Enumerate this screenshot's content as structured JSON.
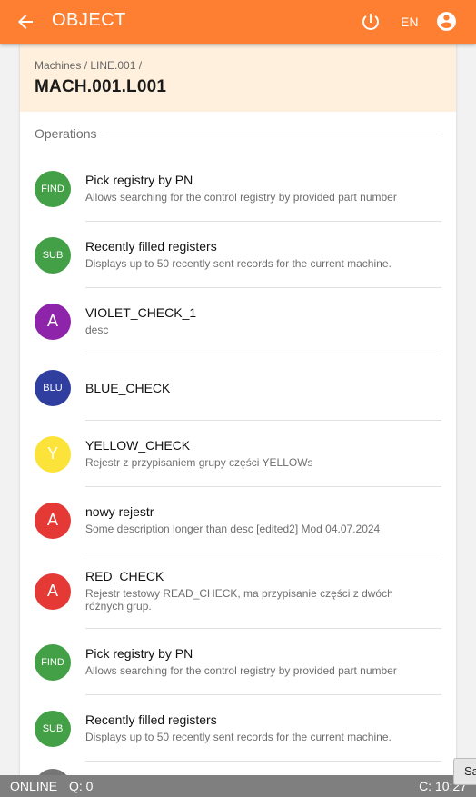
{
  "appbar": {
    "title": "OBJECT",
    "lang": "EN",
    "back_icon": "arrow-left-icon",
    "power_icon": "power-icon",
    "account_icon": "account-circle-icon",
    "color": "#ff7f32"
  },
  "breadcrumb": [
    "Machines",
    "LINE.001"
  ],
  "machine": "MACH.001.L001",
  "section_title": "Operations",
  "operations": [
    {
      "badge": "FIND",
      "color": "#43a047",
      "name": "Pick registry by PN",
      "desc": "Allows searching for the control registry by provided part number"
    },
    {
      "badge": "SUB",
      "color": "#43a047",
      "name": "Recently filled registers",
      "desc": "Displays up to 50 recently sent records for the current machine."
    },
    {
      "badge": "A",
      "color": "#8e24aa",
      "name": "VIOLET_CHECK_1",
      "desc": "desc"
    },
    {
      "badge": "BLU",
      "color": "#303f9f",
      "name": "BLUE_CHECK",
      "desc": ""
    },
    {
      "badge": "Y",
      "color": "#fbe339",
      "name": "YELLOW_CHECK",
      "desc": "Rejestr z przypisaniem grupy części YELLOWs"
    },
    {
      "badge": "A",
      "color": "#e53935",
      "name": "nowy rejestr",
      "desc": "Some description longer than desc [edited2] Mod 04.07.2024"
    },
    {
      "badge": "A",
      "color": "#e53935",
      "name": "RED_CHECK",
      "desc": "Rejestr testowy READ_CHECK, ma przypisanie części z dwóch różnych grup."
    },
    {
      "badge": "FIND",
      "color": "#43a047",
      "name": "Pick registry by PN",
      "desc": "Allows searching for the control registry by provided part number"
    },
    {
      "badge": "SUB",
      "color": "#43a047",
      "name": "Recently filled registers",
      "desc": "Displays up to 50 recently sent records for the current machine."
    }
  ],
  "status": {
    "online": "ONLINE",
    "queue": "Q: 0",
    "clock": "C: 10:27"
  },
  "partial_button": "Sa"
}
